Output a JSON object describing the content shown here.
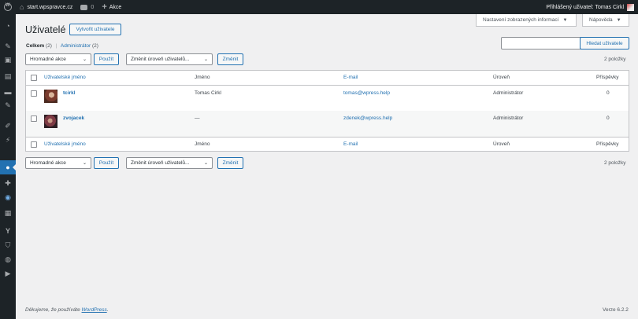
{
  "adminbar": {
    "site_name": "start.wpspravce.cz",
    "comments_count": "0",
    "new_label": "Akce",
    "greeting": "Přihlášený uživatel: Tomas Cirkl"
  },
  "screen_options": {
    "label": "Nastavení zobrazených informací"
  },
  "help": {
    "label": "Nápověda"
  },
  "page": {
    "title": "Uživatelé",
    "add_new": "Vytvořit uživatele"
  },
  "filters": {
    "all_label": "Celkem",
    "all_count": "(2)",
    "separator": "|",
    "admin_label": "Administrátor",
    "admin_count": "(2)"
  },
  "search": {
    "button": "Hledat uživatele"
  },
  "bulk": {
    "select_label": "Hromadné akce",
    "apply": "Použít",
    "role_label": "Změnit úroveň uživatelů...",
    "change": "Změnit"
  },
  "items_count": "2 položky",
  "table": {
    "columns": {
      "username": "Uživatelské jméno",
      "name": "Jméno",
      "email": "E-mail",
      "role": "Úroveň",
      "posts": "Příspěvky"
    },
    "rows": [
      {
        "username": "tcirkl",
        "name": "Tomas Cirkl",
        "email": "tomas@wpress.help",
        "role": "Administrátor",
        "posts": "0"
      },
      {
        "username": "zvojacek",
        "name": "—",
        "email": "zdenek@wpress.help",
        "role": "Administrátor",
        "posts": "0"
      }
    ]
  },
  "footer": {
    "thanks_prefix": "Děkujeme, že používáte",
    "wordpress": "WordPress",
    "thanks_suffix": ".",
    "version": "Verze 6.2.2"
  },
  "icons": {
    "menu": [
      "dashboard-icon",
      "pin-icon",
      "media-icon",
      "pages-icon",
      "comments-icon",
      "pin-icon",
      "appearance-icon",
      "plugins-icon",
      "users-icon",
      "tools-icon",
      "settings-icon",
      "table-icon",
      "yoast-icon",
      "shield-icon",
      "d-plugin-icon",
      "play-icon"
    ]
  },
  "colors": {
    "accent": "#2271b1",
    "adminbar": "#1d2327",
    "background": "#f0f0f1"
  }
}
